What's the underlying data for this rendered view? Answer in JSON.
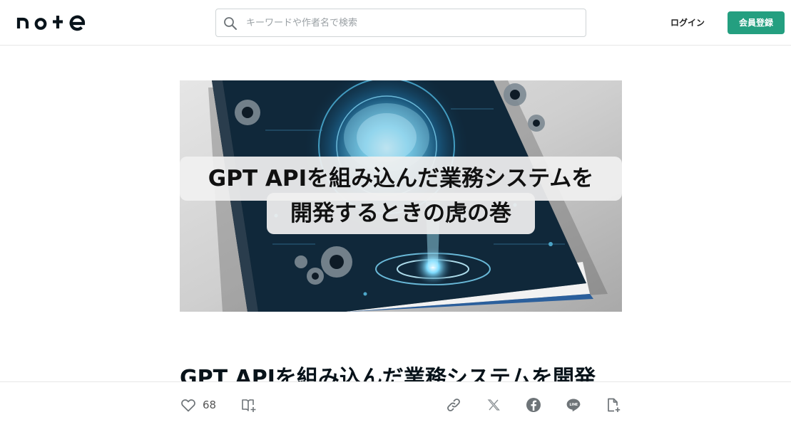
{
  "header": {
    "logo_text": "note",
    "search": {
      "placeholder": "キーワードや作者名で検索",
      "value": ""
    },
    "login_label": "ログイン",
    "signup_label": "会員登録"
  },
  "hero": {
    "title_line1": "GPT APIを組み込んだ業務システムを",
    "title_line2": "開発するときの虎の巻"
  },
  "article": {
    "title": "GPT APIを組み込んだ業務システムを開発"
  },
  "actions": {
    "like_count": "68"
  },
  "icons": {
    "search": "search-icon",
    "like": "heart-icon",
    "magazine": "magazine-add-icon",
    "link": "link-icon",
    "x": "x-logo-icon",
    "facebook": "facebook-icon",
    "line": "line-icon",
    "embed": "document-add-icon"
  },
  "colors": {
    "brand": "#249f80",
    "text": "#08131a",
    "icon": "#6e7478"
  }
}
